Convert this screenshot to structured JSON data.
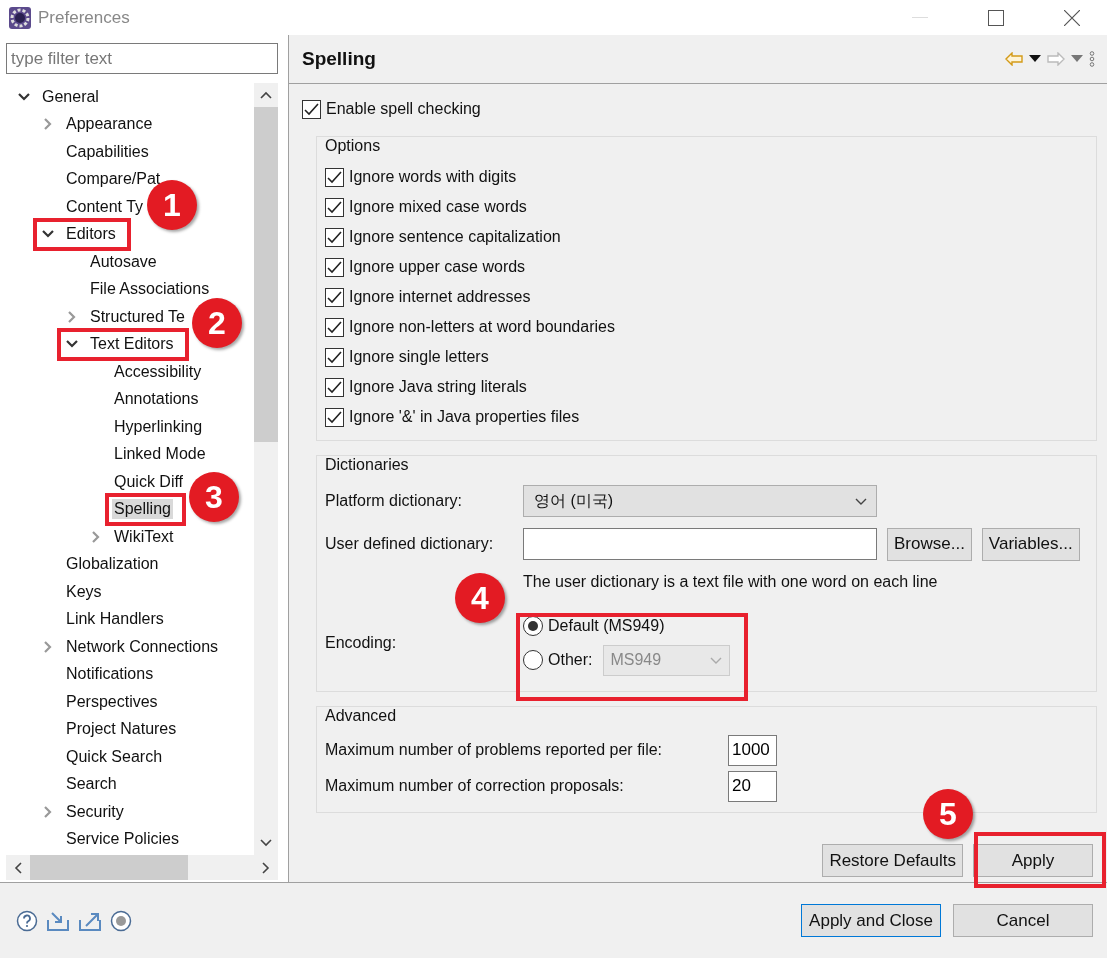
{
  "window": {
    "title": "Preferences"
  },
  "filter": {
    "placeholder": "type filter text"
  },
  "tree": [
    {
      "label": "General",
      "selected": false,
      "expanded": true,
      "children": [
        {
          "label": "Appearance",
          "selected": false,
          "expanded": false
        },
        {
          "label": "Capabilities",
          "selected": false
        },
        {
          "label": "Compare/Pat",
          "selected": false
        },
        {
          "label": "Content Ty",
          "selected": false
        },
        {
          "label": "Editors",
          "selected": false,
          "highlighted": true,
          "expanded": true,
          "children": [
            {
              "label": "Autosave",
              "selected": false
            },
            {
              "label": "File Associations",
              "selected": false
            },
            {
              "label": "Structured Te",
              "selected": false,
              "expanded": false
            },
            {
              "label": "Text Editors",
              "selected": false,
              "highlighted": true,
              "expanded": true,
              "children": [
                {
                  "label": "Accessibility",
                  "selected": false
                },
                {
                  "label": "Annotations",
                  "selected": false
                },
                {
                  "label": "Hyperlinking",
                  "selected": false
                },
                {
                  "label": "Linked Mode",
                  "selected": false
                },
                {
                  "label": "Quick Diff",
                  "selected": false
                },
                {
                  "label": "Spelling",
                  "selected": true,
                  "highlighted": true
                },
                {
                  "label": "WikiText",
                  "selected": false,
                  "expanded": false
                }
              ]
            }
          ]
        },
        {
          "label": "Globalization",
          "selected": false
        },
        {
          "label": "Keys",
          "selected": false
        },
        {
          "label": "Link Handlers",
          "selected": false
        },
        {
          "label": "Network Connections",
          "selected": false,
          "expanded": false
        },
        {
          "label": "Notifications",
          "selected": false
        },
        {
          "label": "Perspectives",
          "selected": false
        },
        {
          "label": "Project Natures",
          "selected": false
        },
        {
          "label": "Quick Search",
          "selected": false
        },
        {
          "label": "Search",
          "selected": false
        },
        {
          "label": "Security",
          "selected": false,
          "expanded": false
        },
        {
          "label": "Service Policies",
          "selected": false
        }
      ]
    }
  ],
  "page": {
    "title": "Spelling",
    "enable": {
      "label": "Enable spell checking",
      "checked": true
    },
    "options": {
      "legend": "Options",
      "items": [
        {
          "label": "Ignore words with digits",
          "checked": true
        },
        {
          "label": "Ignore mixed case words",
          "checked": true
        },
        {
          "label": "Ignore sentence capitalization",
          "checked": true
        },
        {
          "label": "Ignore upper case words",
          "checked": true
        },
        {
          "label": "Ignore internet addresses",
          "checked": true
        },
        {
          "label": "Ignore non-letters at word boundaries",
          "checked": true
        },
        {
          "label": "Ignore single letters",
          "checked": true
        },
        {
          "label": "Ignore Java string literals",
          "checked": true
        },
        {
          "label": "Ignore '&' in Java properties files",
          "checked": true
        }
      ]
    },
    "dictionaries": {
      "legend": "Dictionaries",
      "platform_label": "Platform dictionary:",
      "platform_value": "영어 (미국)",
      "user_label": "User defined dictionary:",
      "browse": "Browse...",
      "variables": "Variables...",
      "hint": "The user dictionary is a text file with one word on each line",
      "encoding_label": "Encoding:",
      "encodings": [
        {
          "label": "Default (MS949)",
          "selected": true
        },
        {
          "label": "Other:",
          "selected": false,
          "value": "MS949",
          "disabled": true
        }
      ]
    },
    "advanced": {
      "legend": "Advanced",
      "rows": [
        {
          "label": "Maximum number of problems reported per file:",
          "value": "1000"
        },
        {
          "label": "Maximum number of correction proposals:",
          "value": "20"
        }
      ]
    },
    "buttons": [
      "Restore Defaults",
      "Apply"
    ]
  },
  "dialog_buttons": [
    {
      "label": "Apply and Close",
      "default": true
    },
    {
      "label": "Cancel",
      "default": false
    }
  ],
  "callouts": [
    {
      "number": "1"
    },
    {
      "number": "2"
    },
    {
      "number": "3"
    },
    {
      "number": "4"
    },
    {
      "number": "5"
    }
  ]
}
